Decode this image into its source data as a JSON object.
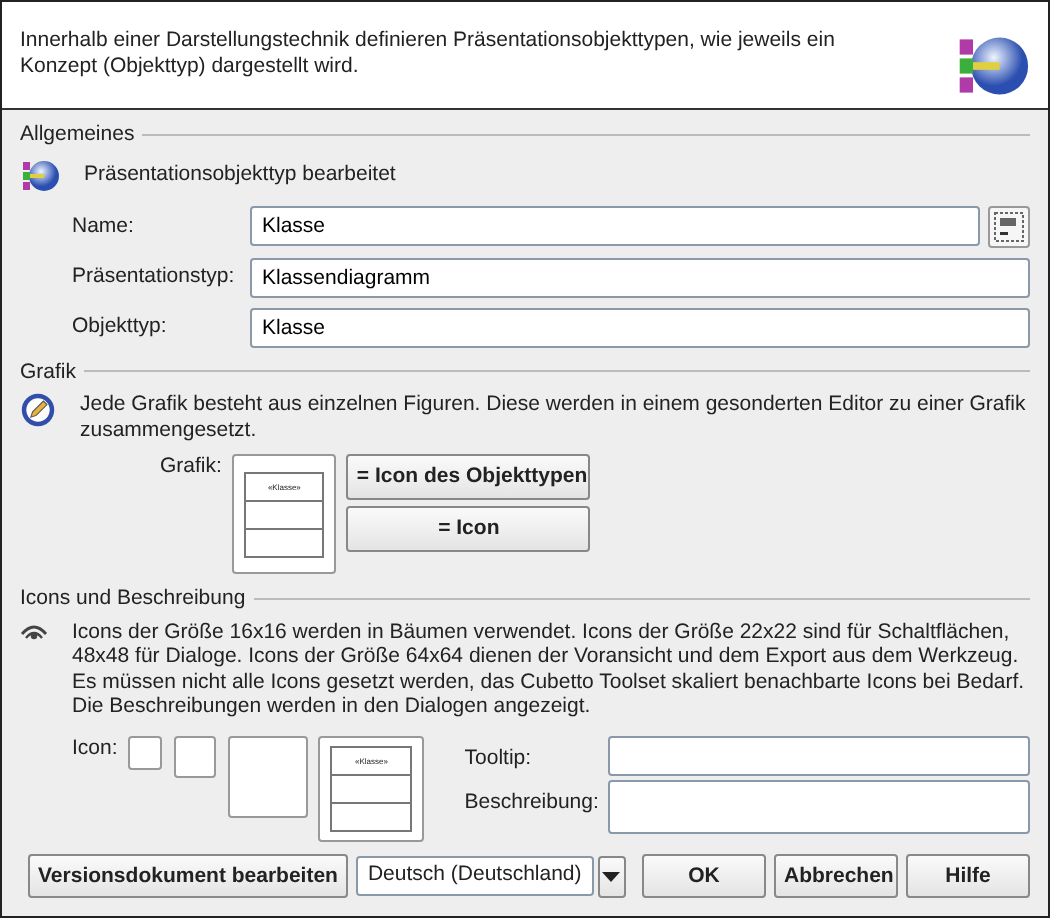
{
  "header": {
    "text": "Innerhalb einer Darstellungstechnik definieren Präsentationsobjekttypen, wie jeweils ein Konzept (Objekttyp) dargestellt wird."
  },
  "sections": [
    {
      "kind": "general",
      "title": "Allgemeines",
      "info": "Präsentationsobjekttyp bearbeitet",
      "fields": [
        {
          "label": "Name:",
          "value": "Klasse",
          "has_button": true
        },
        {
          "label": "Präsentationstyp:",
          "value": "Klassendiagramm",
          "has_button": false
        },
        {
          "label": "Objekttyp:",
          "value": "Klasse",
          "has_button": false
        }
      ]
    },
    {
      "kind": "graphic",
      "title": "Grafik",
      "info": "Jede Grafik besteht aus einzelnen Figuren. Diese werden in einem gesonderten Editor zu einer Grafik zusammengesetzt.",
      "label": "Grafik:",
      "preview_label": "«Klasse»",
      "buttons": [
        "= Icon des Objekttypen",
        "= Icon"
      ]
    },
    {
      "kind": "icons",
      "title": "Icons und Beschreibung",
      "info": "Icons der Größe 16x16 werden in Bäumen verwendet. Icons der Größe 22x22 sind für Schaltflächen, 48x48 für Dialoge. Icons der Größe 64x64 dienen der Voransicht und dem Export aus dem Werkzeug. Es müssen nicht alle Icons gesetzt werden, das Cubetto Toolset skaliert benachbarte Icons bei Bedarf. Die Beschreibungen werden in den Dialogen angezeigt.",
      "label": "Icon:",
      "preview_label": "«Klasse»",
      "fields": [
        {
          "label": "Tooltip:"
        },
        {
          "label": "Beschreibung:"
        }
      ]
    }
  ],
  "footer": {
    "version_button": "Versionsdokument bearbeiten",
    "language": "Deutsch (Deutschland)",
    "buttons": [
      "OK",
      "Abbrechen",
      "Hilfe"
    ]
  }
}
